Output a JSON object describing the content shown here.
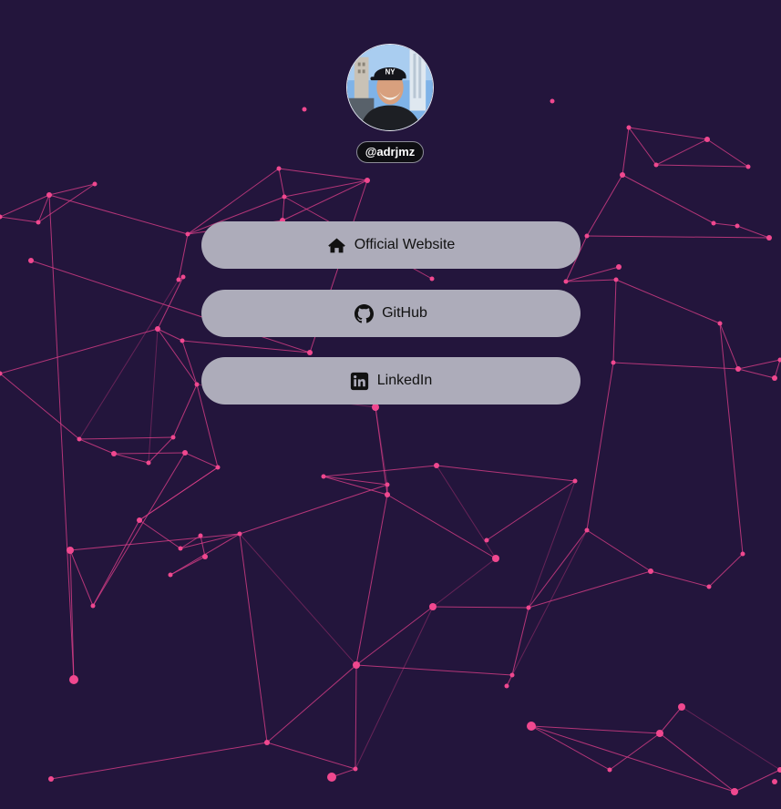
{
  "profile": {
    "handle": "@adrjmz"
  },
  "links": [
    {
      "label": "Official Website",
      "icon": "home-icon"
    },
    {
      "label": "GitHub",
      "icon": "github-icon"
    },
    {
      "label": "LinkedIn",
      "icon": "linkedin-icon"
    }
  ],
  "colors": {
    "background": "#23153c",
    "network_lines": "#e4408c",
    "button_fill": "#adacba",
    "handle_badge": "#0e0e12"
  }
}
